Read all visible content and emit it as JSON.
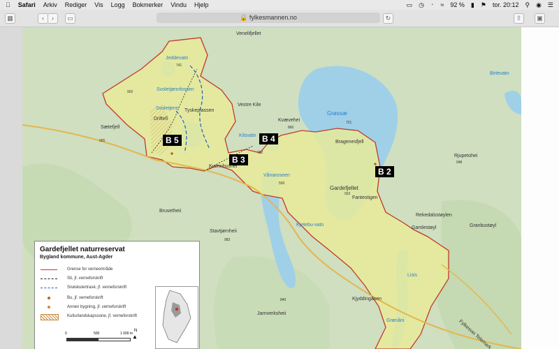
{
  "menubar": {
    "apple": "",
    "app_name": "Safari",
    "items": [
      "Arkiv",
      "Rediger",
      "Vis",
      "Logg",
      "Bokmerker",
      "Vindu",
      "Hjelp"
    ],
    "battery": "92 %",
    "clock": "tor. 20:12"
  },
  "browser": {
    "url": "fylkesmannen.no"
  },
  "map": {
    "reserve_labels": [
      "B 5",
      "B 4",
      "B 3",
      "B 2"
    ],
    "place_names": [
      "Venelifjellet",
      "Sætefjell",
      "Driftelî",
      "Tyskeplassen",
      "Vestre Kile",
      "Kvævehei",
      "Bragenesfjell",
      "Rjupetohei",
      "Kvennhushei",
      "Gardefjellet",
      "Fantestigen",
      "Brusetheii",
      "Stavtjørnheii",
      "Rekedalsstøylen",
      "Gamlestøyl",
      "Granbustøyl",
      "Kjyddingåsen",
      "Jarnverksheii"
    ],
    "water_names": [
      "Jeddevatn",
      "Svoletjønnfossen",
      "Svoletjenn",
      "Kilsvatn",
      "Grøssæ",
      "Birtevatn",
      "Vånaroseen",
      "Kjetebu-vatn",
      "Lisis",
      "Grønåni"
    ],
    "heights": [
      "741",
      "902",
      "965",
      "860",
      "721",
      "782",
      "948",
      "932",
      "550",
      "983",
      "840"
    ],
    "road_label": "Fylkesvei Telemark"
  },
  "legend": {
    "title": "Gardefjellet naturreservat",
    "subtitle": "Bygland kommune, Aust-Agder",
    "items": [
      {
        "label": "Grense for verneområde",
        "color": "#c0392b",
        "style": "solid"
      },
      {
        "label": "Sti, jf. verneforskrift",
        "color": "#222",
        "style": "dashed"
      },
      {
        "label": "Snøskutertrasé, jf. verneforskrift",
        "color": "#1f5fbf",
        "style": "dashed"
      },
      {
        "label": "Bu, jf. verneforskrift",
        "color": "#b5651d",
        "style": "dot"
      },
      {
        "label": "Annen bygning, jf. verneforskrift",
        "color": "#c98a3c",
        "style": "dot"
      },
      {
        "label": "Kulturlandskapssone, jf. verneforskrift",
        "color": "#c98a3c",
        "style": "hatch"
      }
    ],
    "scale_labels": [
      "0",
      "500",
      "1 000 m"
    ],
    "north": "N"
  }
}
